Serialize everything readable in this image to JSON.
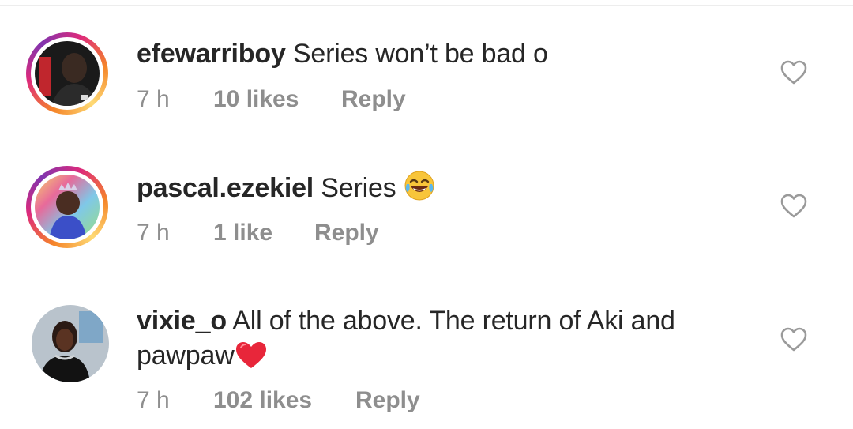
{
  "comments": [
    {
      "username": "efewarriboy",
      "text": "Series won’t be bad o",
      "time": "7 h",
      "likes": "10 likes",
      "reply": "Reply",
      "avatar_icon": "album-cover-avatar",
      "has_story_ring": true
    },
    {
      "username": "pascal.ezekiel",
      "text": "Series",
      "emoji": "tears-of-joy-emoji",
      "time": "7 h",
      "likes": "1 like",
      "reply": "Reply",
      "avatar_icon": "crowned-child-avatar",
      "has_story_ring": true
    },
    {
      "username": "vixie_o",
      "text_line1": "All of the above. The return of Aki and",
      "text_line2": "pawpaw",
      "emoji": "red-heart-emoji",
      "time": "7 h",
      "likes": "102 likes",
      "reply": "Reply",
      "avatar_icon": "woman-photo-avatar",
      "has_story_ring": false
    }
  ],
  "colors": {
    "text": "#262626",
    "meta": "#8e8e8e",
    "heart_emoji": "#e8263a",
    "story_ring_start": "#f58529",
    "story_ring_end": "#dd2a7b"
  }
}
